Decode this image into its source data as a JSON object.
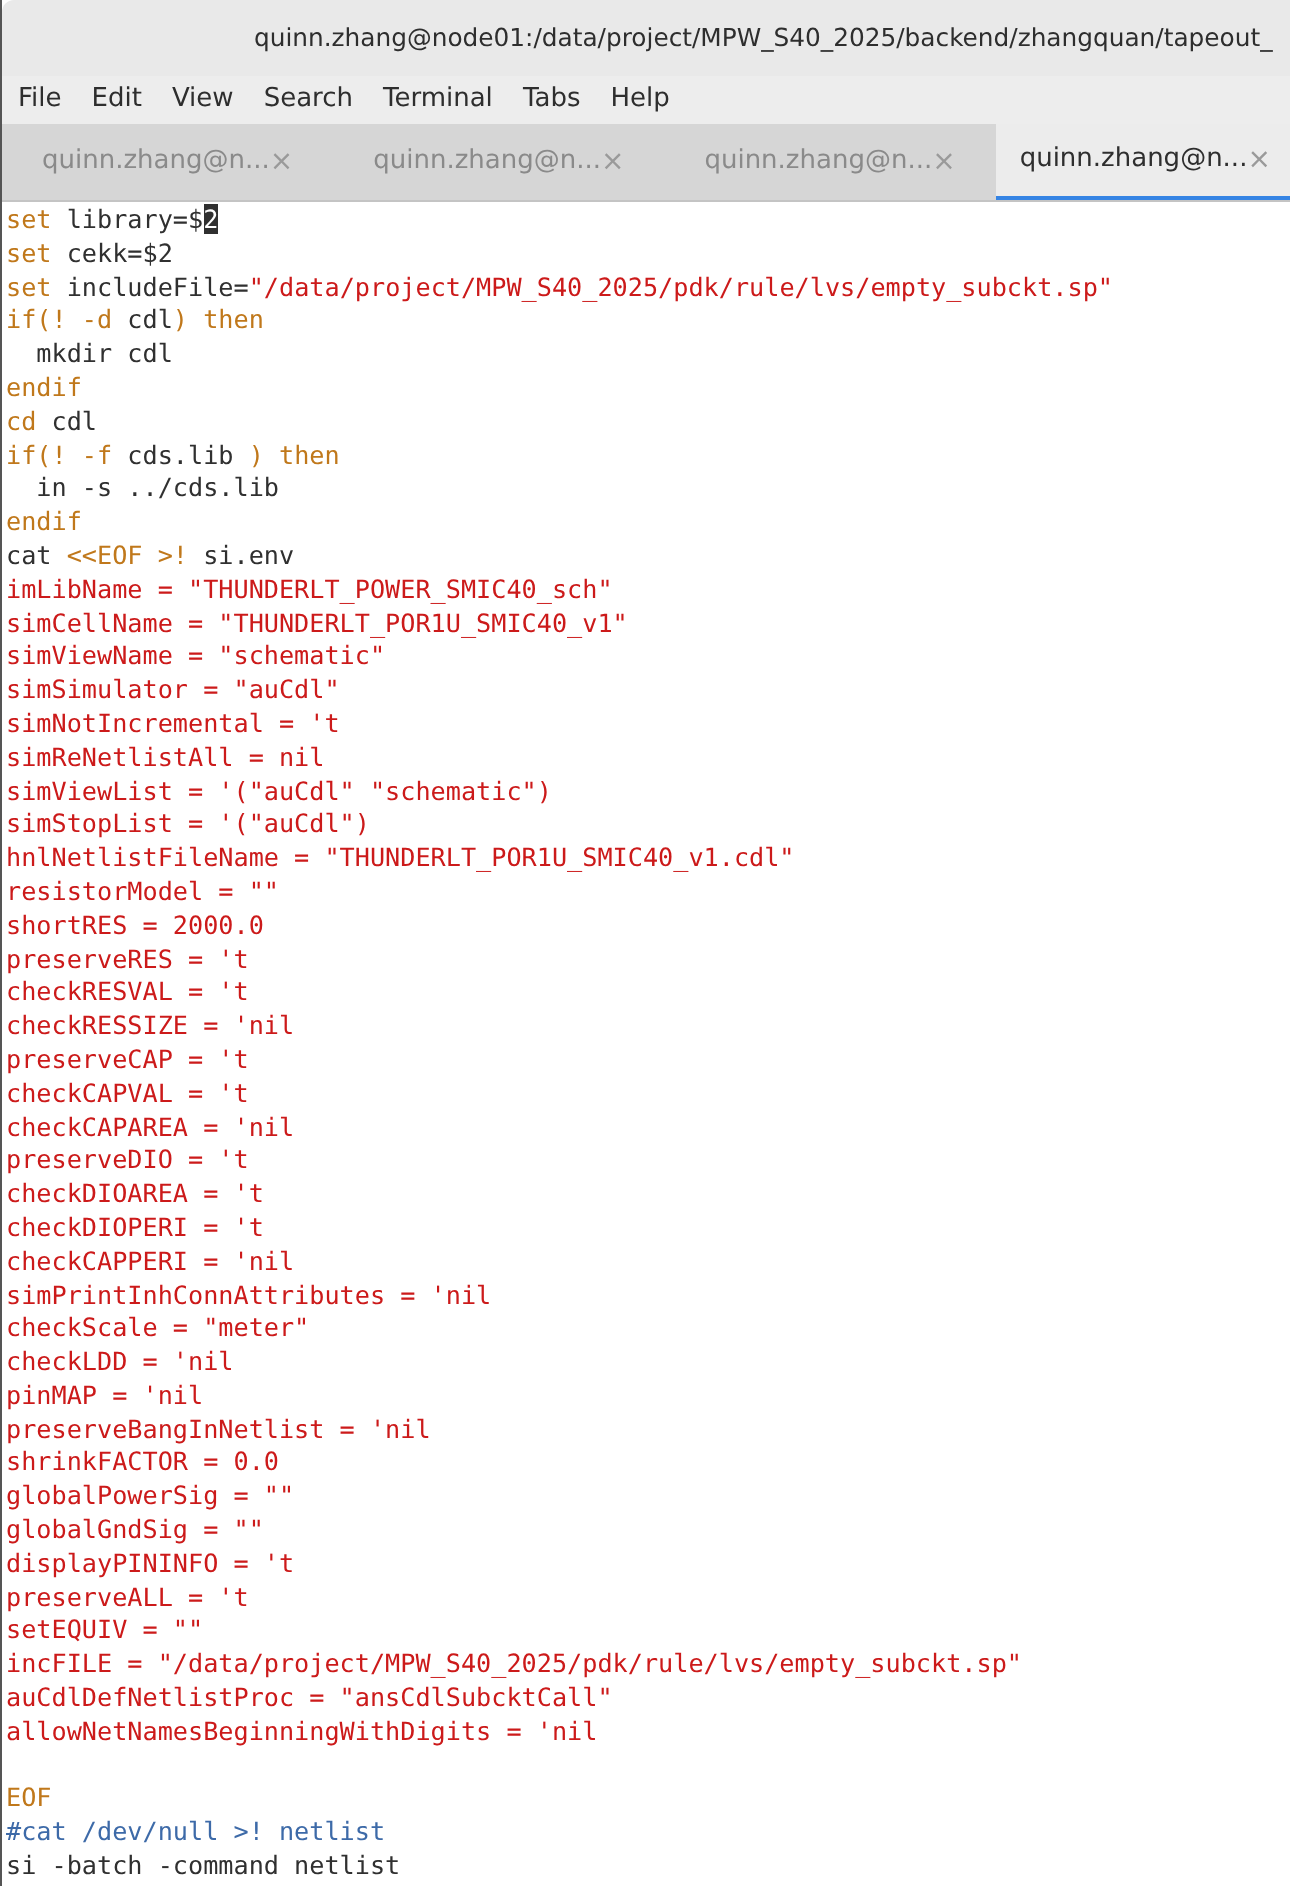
{
  "window": {
    "title": "quinn.zhang@node01:/data/project/MPW_S40_2025/backend/zhangquan/tapeout_"
  },
  "menu": [
    "File",
    "Edit",
    "View",
    "Search",
    "Terminal",
    "Tabs",
    "Help"
  ],
  "tabs": [
    {
      "label": "quinn.zhang@n...",
      "close": "×",
      "selected": false
    },
    {
      "label": "quinn.zhang@n...",
      "close": "×",
      "selected": false
    },
    {
      "label": "quinn.zhang@n...",
      "close": "×",
      "selected": false
    },
    {
      "label": "quinn.zhang@n...",
      "close": "×",
      "selected": true
    }
  ],
  "terminal": {
    "lines": [
      [
        {
          "kind": "keyword",
          "text": "set"
        },
        {
          "kind": "plain",
          "text": " library=$"
        },
        {
          "kind": "cursor",
          "text": "2"
        }
      ],
      [
        {
          "kind": "keyword",
          "text": "set"
        },
        {
          "kind": "plain",
          "text": " cekk=$2"
        }
      ],
      [
        {
          "kind": "keyword",
          "text": "set"
        },
        {
          "kind": "plain",
          "text": " includeFile="
        },
        {
          "kind": "string",
          "text": "\"/data/project/MPW_S40_2025/pdk/rule/lvs/empty_subckt.sp\""
        }
      ],
      [
        {
          "kind": "keyword",
          "text": "if(! -d "
        },
        {
          "kind": "plain",
          "text": "cdl"
        },
        {
          "kind": "keyword",
          "text": ") then"
        }
      ],
      [
        {
          "kind": "plain",
          "text": "  mkdir cdl"
        }
      ],
      [
        {
          "kind": "keyword",
          "text": "endif"
        }
      ],
      [
        {
          "kind": "keyword",
          "text": "cd"
        },
        {
          "kind": "plain",
          "text": " cdl"
        }
      ],
      [
        {
          "kind": "keyword",
          "text": "if(! -f "
        },
        {
          "kind": "plain",
          "text": "cds.lib "
        },
        {
          "kind": "keyword",
          "text": ") then"
        }
      ],
      [
        {
          "kind": "plain",
          "text": "  in -s ../cds.lib"
        }
      ],
      [
        {
          "kind": "keyword",
          "text": "endif"
        }
      ],
      [
        {
          "kind": "plain",
          "text": "cat "
        },
        {
          "kind": "keyword",
          "text": "<<EOF >!"
        },
        {
          "kind": "plain",
          "text": " si.env"
        }
      ],
      [
        {
          "kind": "string",
          "text": "imLibName = \"THUNDERLT_POWER_SMIC40_sch\""
        }
      ],
      [
        {
          "kind": "string",
          "text": "simCellName = \"THUNDERLT_POR1U_SMIC40_v1\""
        }
      ],
      [
        {
          "kind": "string",
          "text": "simViewName = \"schematic\""
        }
      ],
      [
        {
          "kind": "string",
          "text": "simSimulator = \"auCdl\""
        }
      ],
      [
        {
          "kind": "string",
          "text": "simNotIncremental = 't"
        }
      ],
      [
        {
          "kind": "string",
          "text": "simReNetlistAll = nil"
        }
      ],
      [
        {
          "kind": "string",
          "text": "simViewList = '(\"auCdl\" \"schematic\")"
        }
      ],
      [
        {
          "kind": "string",
          "text": "simStopList = '(\"auCdl\")"
        }
      ],
      [
        {
          "kind": "string",
          "text": "hnlNetlistFileName = \"THUNDERLT_POR1U_SMIC40_v1.cdl\""
        }
      ],
      [
        {
          "kind": "string",
          "text": "resistorModel = \"\""
        }
      ],
      [
        {
          "kind": "string",
          "text": "shortRES = 2000.0"
        }
      ],
      [
        {
          "kind": "string",
          "text": "preserveRES = 't"
        }
      ],
      [
        {
          "kind": "string",
          "text": "checkRESVAL = 't"
        }
      ],
      [
        {
          "kind": "string",
          "text": "checkRESSIZE = 'nil"
        }
      ],
      [
        {
          "kind": "string",
          "text": "preserveCAP = 't"
        }
      ],
      [
        {
          "kind": "string",
          "text": "checkCAPVAL = 't"
        }
      ],
      [
        {
          "kind": "string",
          "text": "checkCAPAREA = 'nil"
        }
      ],
      [
        {
          "kind": "string",
          "text": "preserveDIO = 't"
        }
      ],
      [
        {
          "kind": "string",
          "text": "checkDIOAREA = 't"
        }
      ],
      [
        {
          "kind": "string",
          "text": "checkDIOPERI = 't"
        }
      ],
      [
        {
          "kind": "string",
          "text": "checkCAPPERI = 'nil"
        }
      ],
      [
        {
          "kind": "string",
          "text": "simPrintInhConnAttributes = 'nil"
        }
      ],
      [
        {
          "kind": "string",
          "text": "checkScale = \"meter\""
        }
      ],
      [
        {
          "kind": "string",
          "text": "checkLDD = 'nil"
        }
      ],
      [
        {
          "kind": "string",
          "text": "pinMAP = 'nil"
        }
      ],
      [
        {
          "kind": "string",
          "text": "preserveBangInNetlist = 'nil"
        }
      ],
      [
        {
          "kind": "string",
          "text": "shrinkFACTOR = 0.0"
        }
      ],
      [
        {
          "kind": "string",
          "text": "globalPowerSig = \"\""
        }
      ],
      [
        {
          "kind": "string",
          "text": "globalGndSig = \"\""
        }
      ],
      [
        {
          "kind": "string",
          "text": "displayPININFO = 't"
        }
      ],
      [
        {
          "kind": "string",
          "text": "preserveALL = 't"
        }
      ],
      [
        {
          "kind": "string",
          "text": "setEQUIV = \"\""
        }
      ],
      [
        {
          "kind": "string",
          "text": "incFILE = \"/data/project/MPW_S40_2025/pdk/rule/lvs/empty_subckt.sp\""
        }
      ],
      [
        {
          "kind": "string",
          "text": "auCdlDefNetlistProc = \"ansCdlSubcktCall\""
        }
      ],
      [
        {
          "kind": "string",
          "text": "allowNetNamesBeginningWithDigits = 'nil"
        }
      ],
      [
        {
          "kind": "keyword",
          "text": "EOF",
          "blank_line_before": true
        }
      ],
      [
        {
          "kind": "comment",
          "text": "#cat /dev/null >! netlist"
        }
      ],
      [
        {
          "kind": "plain",
          "text": "si -batch -command netlist"
        }
      ]
    ]
  }
}
